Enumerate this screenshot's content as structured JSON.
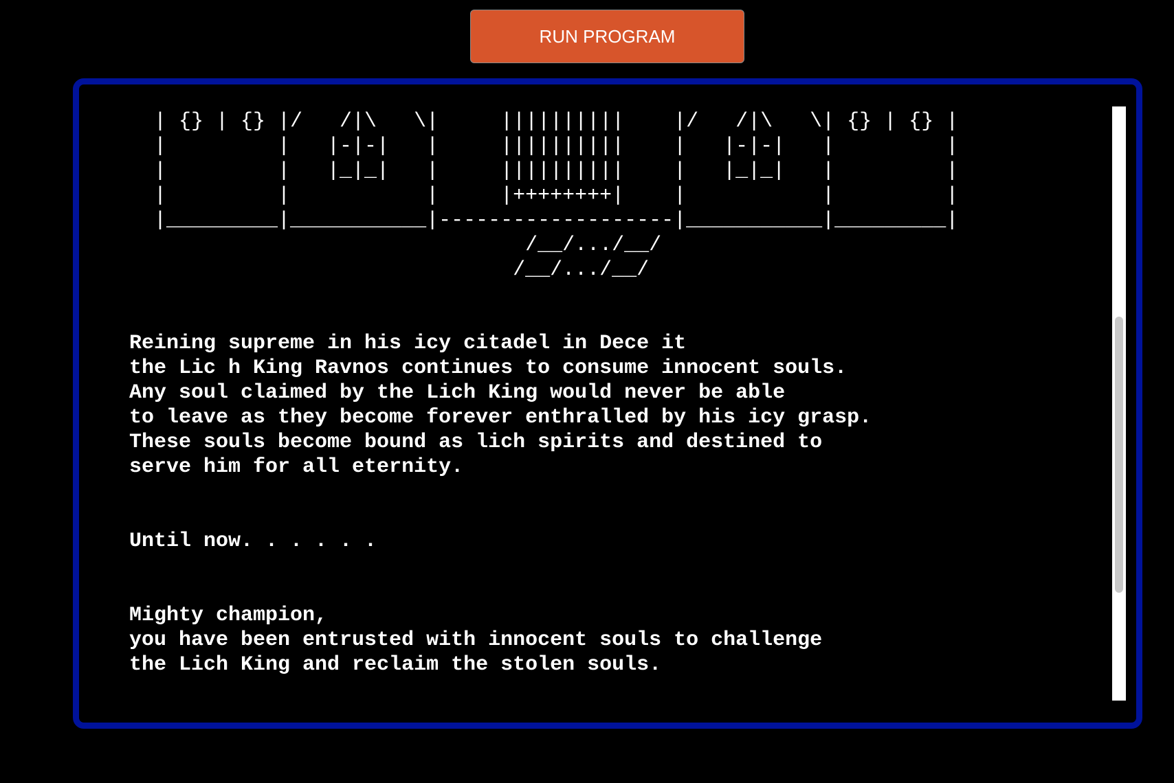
{
  "toolbar": {
    "run_label": "RUN PROGRAM"
  },
  "terminal": {
    "ascii_art": "  | {} | {} |/   /|\\   \\|     ||||||||||    |/   /|\\   \\| {} | {} |\n  |         |   |-|-|   |     ||||||||||    |   |-|-|   |         |\n  |         |   |_|_|   |     ||||||||||    |   |_|_|   |         |\n  |         |           |     |++++++++|    |           |         |\n  |_________|___________|-------------------|___________|_________|\n                                /__/.../__/\n                               /__/.../__/",
    "story": "Reining supreme in his icy citadel in Dece it\nthe Lic h King Ravnos continues to consume innocent souls.\nAny soul claimed by the Lich King would never be able\nto leave as they become forever enthralled by his icy grasp.\nThese souls become bound as lich spirits and destined to\nserve him for all eternity.\n\n\nUntil now. . . . . .\n\n\nMighty champion,\nyou have been entrusted with innocent souls to challenge\nthe Lich King and reclaim the stolen souls."
  },
  "colors": {
    "background": "#000000",
    "run_button": "#d7552b",
    "frame_border": "#00129a",
    "text": "#ffffff"
  }
}
